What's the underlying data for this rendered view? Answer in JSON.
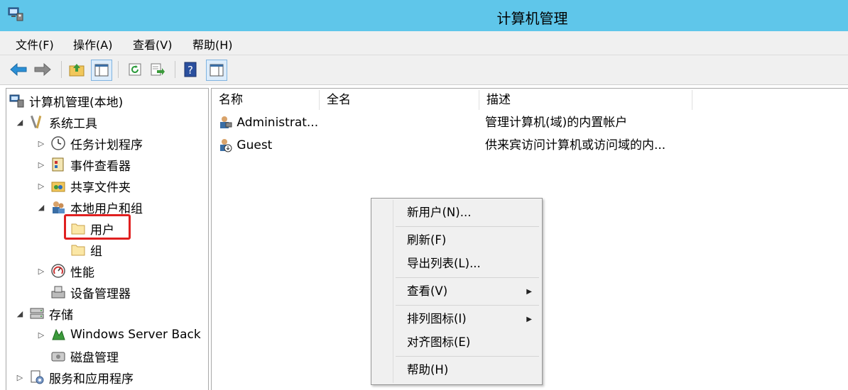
{
  "window": {
    "title": "计算机管理"
  },
  "menubar": {
    "file": "文件(F)",
    "action": "操作(A)",
    "view": "查看(V)",
    "help": "帮助(H)"
  },
  "toolbar": {
    "icons": [
      "back-arrow-icon",
      "forward-arrow-icon",
      "up-folder-icon",
      "show-hide-tree-icon",
      "refresh-icon",
      "export-list-icon",
      "help-icon",
      "action-pane-icon"
    ]
  },
  "tree": {
    "root": "计算机管理(本地)",
    "system_tools": "系统工具",
    "task_scheduler": "任务计划程序",
    "event_viewer": "事件查看器",
    "shared_folders": "共享文件夹",
    "local_users_groups": "本地用户和组",
    "users": "用户",
    "groups": "组",
    "performance": "性能",
    "device_manager": "设备管理器",
    "storage": "存储",
    "windows_server_backup": "Windows Server Back",
    "disk_management": "磁盘管理",
    "services_apps": "服务和应用程序"
  },
  "list": {
    "columns": [
      "名称",
      "全名",
      "描述"
    ],
    "rows": [
      {
        "name": "Administrat...",
        "fullname": "",
        "desc": "管理计算机(域)的内置帐户"
      },
      {
        "name": "Guest",
        "fullname": "",
        "desc": "供来宾访问计算机或访问域的内..."
      }
    ]
  },
  "context_menu": {
    "new_user": "新用户(N)...",
    "refresh": "刷新(F)",
    "export_list": "导出列表(L)...",
    "view": "查看(V)",
    "arrange_icons": "排列图标(I)",
    "align_icons": "对齐图标(E)",
    "help": "帮助(H)"
  },
  "colors": {
    "titlebar": "#5fc6ea",
    "highlight": "#e02020"
  }
}
